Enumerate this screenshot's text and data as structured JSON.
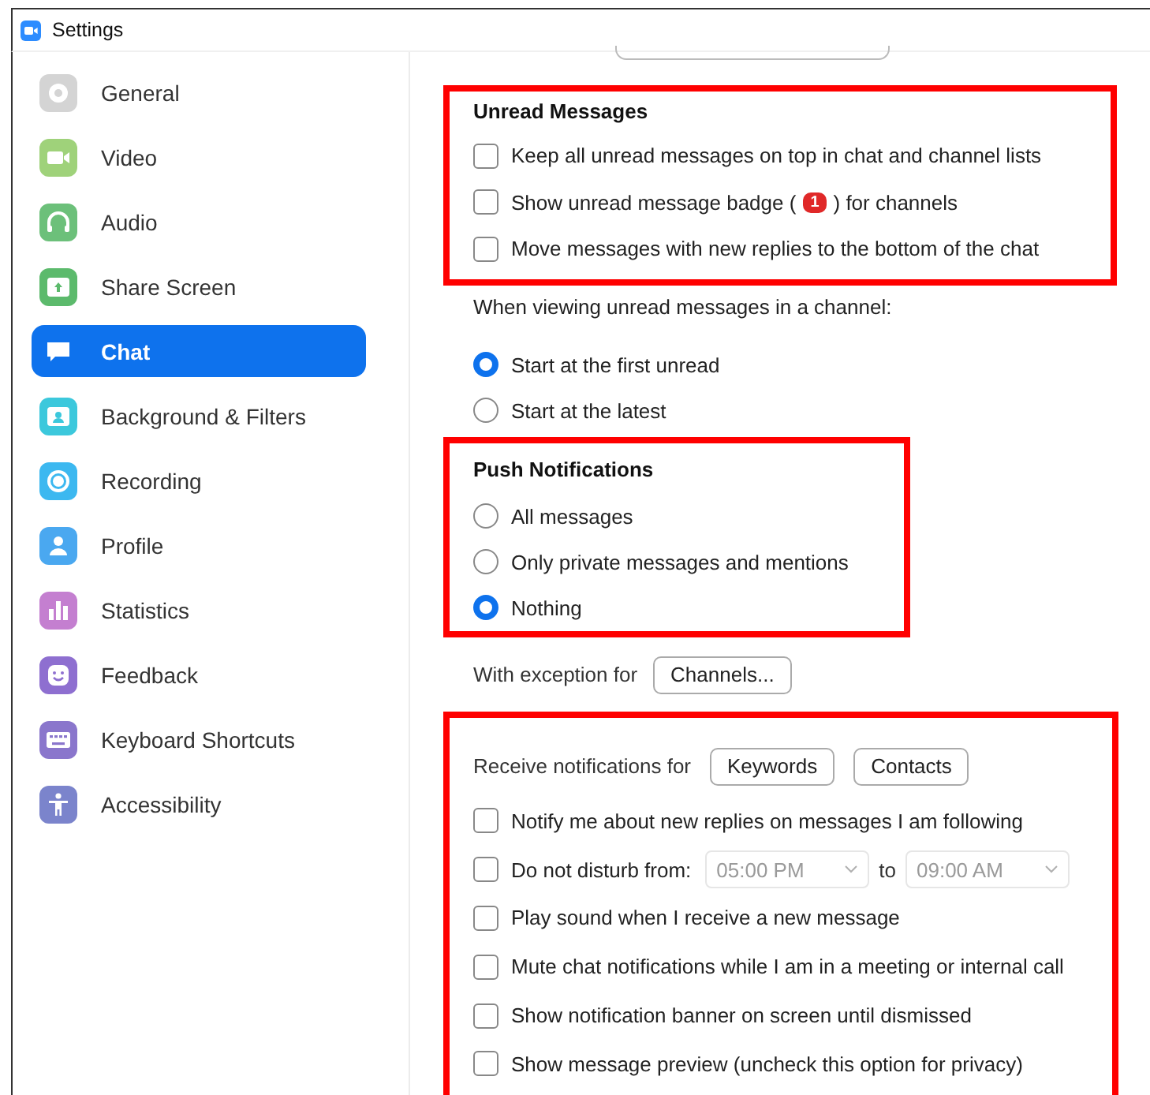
{
  "window": {
    "title": "Settings"
  },
  "sidebar": {
    "items": [
      {
        "label": "General",
        "selected": false
      },
      {
        "label": "Video",
        "selected": false
      },
      {
        "label": "Audio",
        "selected": false
      },
      {
        "label": "Share Screen",
        "selected": false
      },
      {
        "label": "Chat",
        "selected": true
      },
      {
        "label": "Background & Filters",
        "selected": false
      },
      {
        "label": "Recording",
        "selected": false
      },
      {
        "label": "Profile",
        "selected": false
      },
      {
        "label": "Statistics",
        "selected": false
      },
      {
        "label": "Feedback",
        "selected": false
      },
      {
        "label": "Keyboard Shortcuts",
        "selected": false
      },
      {
        "label": "Accessibility",
        "selected": false
      }
    ]
  },
  "unread_messages": {
    "title": "Unread Messages",
    "highlighted": true,
    "options": [
      {
        "label": "Keep all unread messages on top in chat and channel lists",
        "checked": false
      },
      {
        "label": "Show unread message badge (",
        "badge": "1",
        "label_after": ") for channels",
        "checked": false
      },
      {
        "label": "Move messages with new replies to the bottom of the chat",
        "checked": false
      }
    ]
  },
  "unread_view": {
    "prompt": "When viewing unread messages in a channel:",
    "options": [
      {
        "label": "Start at the first unread",
        "selected": true
      },
      {
        "label": "Start at the latest",
        "selected": false
      }
    ]
  },
  "push_notifications": {
    "title": "Push Notifications",
    "highlighted": true,
    "options": [
      {
        "label": "All messages",
        "selected": false
      },
      {
        "label": "Only private messages and mentions",
        "selected": false
      },
      {
        "label": "Nothing",
        "selected": true
      }
    ]
  },
  "exception": {
    "label": "With exception for",
    "button": "Channels..."
  },
  "notifications": {
    "highlighted": true,
    "label": "Receive notifications for",
    "buttons": [
      "Keywords",
      "Contacts"
    ],
    "options": [
      {
        "kind": "checkbox",
        "label": "Notify me about new replies on messages I am following",
        "checked": false
      },
      {
        "kind": "time_range",
        "label": "Do not disturb from:",
        "checked": false,
        "from": "05:00 PM",
        "separator": "to",
        "until": "09:00 AM"
      },
      {
        "kind": "checkbox",
        "label": "Play sound when I receive a new message",
        "checked": false
      },
      {
        "kind": "checkbox",
        "label": "Mute chat notifications while I am in a meeting or internal call",
        "checked": false
      },
      {
        "kind": "checkbox",
        "label": "Show notification banner on screen until dismissed",
        "checked": false
      },
      {
        "kind": "checkbox",
        "label": "Show message preview (uncheck this option for privacy)",
        "checked": false
      }
    ]
  }
}
